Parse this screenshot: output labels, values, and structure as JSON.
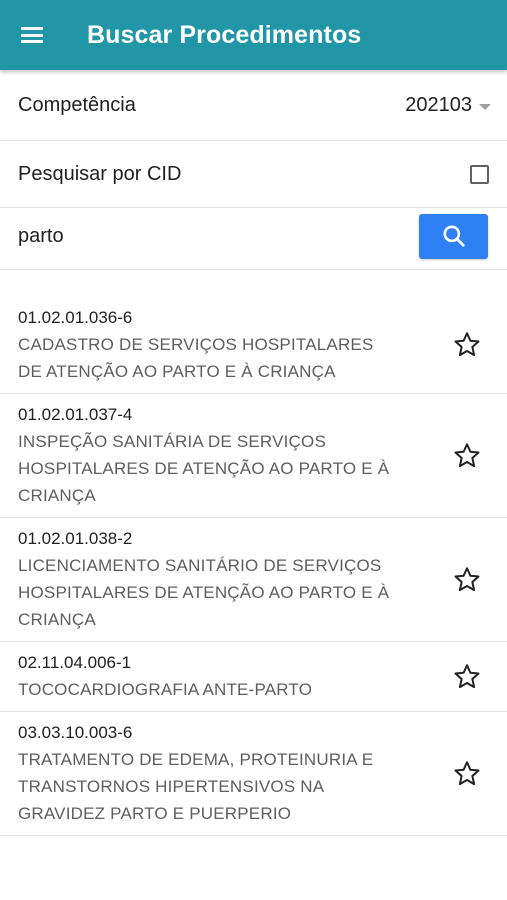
{
  "appbar": {
    "title": "Buscar Procedimentos",
    "color": "#2096a6"
  },
  "form": {
    "competencia_label": "Competência",
    "competencia_value": "202103",
    "cid_label": "Pesquisar por CID",
    "cid_checked": false,
    "search_value": "parto",
    "search_button_color": "#2f80f5"
  },
  "results": [
    {
      "code": "01.02.01.036-6",
      "description": "CADASTRO DE SERVIÇOS HOSPITALARES DE ATENÇÃO AO PARTO E À CRIANÇA"
    },
    {
      "code": "01.02.01.037-4",
      "description": "INSPEÇÃO SANITÁRIA DE SERVIÇOS HOSPITALARES DE ATENÇÃO AO PARTO E À CRIANÇA"
    },
    {
      "code": "01.02.01.038-2",
      "description": "LICENCIAMENTO SANITÁRIO DE SERVIÇOS HOSPITALARES DE ATENÇÃO AO PARTO E À CRIANÇA"
    },
    {
      "code": "02.11.04.006-1",
      "description": "TOCOCARDIOGRAFIA ANTE-PARTO"
    },
    {
      "code": "03.03.10.003-6",
      "description": "TRATAMENTO DE EDEMA, PROTEINURIA E TRANSTORNOS HIPERTENSIVOS NA GRAVIDEZ PARTO E PUERPERIO"
    }
  ],
  "icons": {
    "menu": "hamburger-menu-icon",
    "dropdown": "caret-down-icon",
    "search": "search-icon",
    "favorite": "star-outline-icon"
  }
}
